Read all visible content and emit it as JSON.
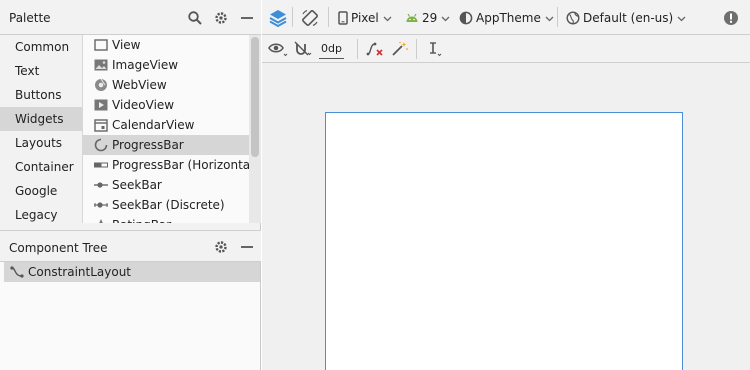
{
  "palette": {
    "title": "Palette",
    "categories": [
      {
        "label": "Common",
        "selected": false
      },
      {
        "label": "Text",
        "selected": false
      },
      {
        "label": "Buttons",
        "selected": false
      },
      {
        "label": "Widgets",
        "selected": true
      },
      {
        "label": "Layouts",
        "selected": false
      },
      {
        "label": "Container",
        "selected": false
      },
      {
        "label": "Google",
        "selected": false
      },
      {
        "label": "Legacy",
        "selected": false
      }
    ],
    "widgets": [
      {
        "label": "View",
        "icon": "view-icon"
      },
      {
        "label": "ImageView",
        "icon": "image-icon"
      },
      {
        "label": "WebView",
        "icon": "web-icon"
      },
      {
        "label": "VideoView",
        "icon": "video-icon"
      },
      {
        "label": "CalendarView",
        "icon": "calendar-icon"
      },
      {
        "label": "ProgressBar",
        "icon": "progress-icon",
        "selected": true
      },
      {
        "label": "ProgressBar (Horizontal)",
        "icon": "progress-horizontal-icon"
      },
      {
        "label": "SeekBar",
        "icon": "seekbar-icon"
      },
      {
        "label": "SeekBar (Discrete)",
        "icon": "seekbar-discrete-icon"
      },
      {
        "label": "RatingBar",
        "icon": "star-icon"
      }
    ]
  },
  "component_tree": {
    "title": "Component Tree",
    "root": "ConstraintLayout"
  },
  "toolbar": {
    "device": "Pixel",
    "api_level": "29",
    "theme": "AppTheme",
    "locale": "Default (en-us)"
  },
  "toolbar2": {
    "default_margin": "0dp"
  },
  "colors": {
    "accent": "#3f8ed8",
    "android_green": "#7cb342",
    "device_border": "#4a8fd6",
    "selected_row": "#d6d6d6"
  }
}
